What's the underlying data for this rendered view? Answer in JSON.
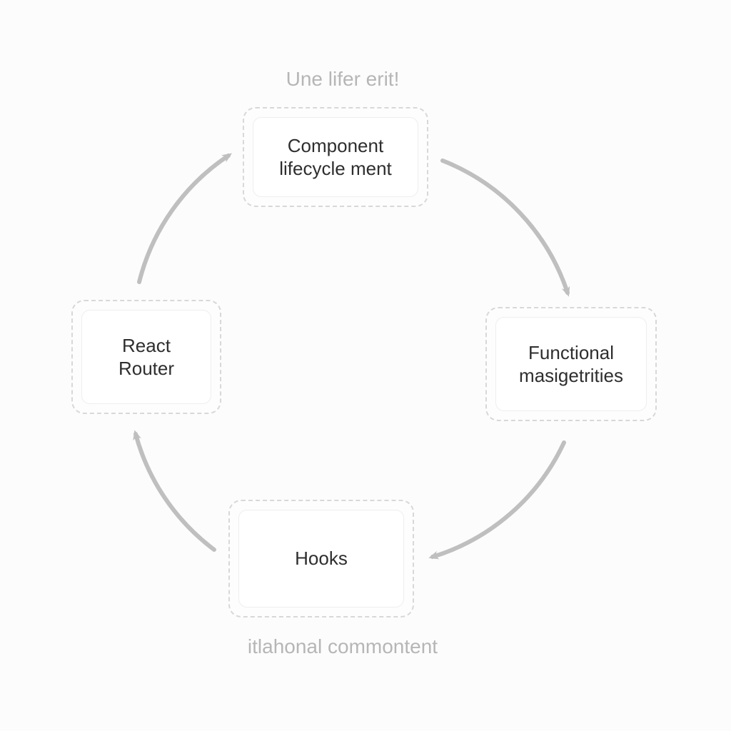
{
  "diagram": {
    "type": "cycle",
    "nodes": {
      "top": {
        "label": "Component lifecycle ment"
      },
      "right": {
        "label": "Functional masigetrities"
      },
      "bottom": {
        "label": "Hooks"
      },
      "left": {
        "label": "React Router"
      }
    },
    "captions": {
      "top": "Une lifer erit!",
      "bottom": "itlahonal commontent"
    },
    "arrow_color": "#bfbfbf"
  }
}
